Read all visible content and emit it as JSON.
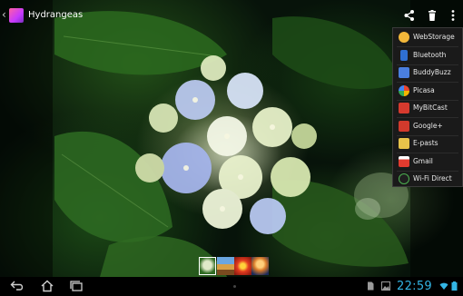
{
  "app": {
    "album_title": "Hydrangeas"
  },
  "action_bar": {
    "icons": [
      "back-caret-icon",
      "album-thumbnail-icon",
      "share-icon",
      "trash-icon",
      "overflow-menu-icon"
    ]
  },
  "share_menu": {
    "items": [
      {
        "label": "WebStorage",
        "icon": "webstorage-icon",
        "color": "#f2b73a"
      },
      {
        "label": "Bluetooth",
        "icon": "bluetooth-icon",
        "color": "#2f6fd1"
      },
      {
        "label": "BuddyBuzz",
        "icon": "buddybuzz-icon",
        "color": "#4a7fe0"
      },
      {
        "label": "Picasa",
        "icon": "picasa-icon",
        "color": "#e86a2f"
      },
      {
        "label": "MyBitCast",
        "icon": "mybitcast-icon",
        "color": "#d63a2e"
      },
      {
        "label": "Google+",
        "icon": "google-plus-icon",
        "color": "#d23a2c"
      },
      {
        "label": "E-pasts",
        "icon": "email-icon",
        "color": "#e8c34a"
      },
      {
        "label": "Gmail",
        "icon": "gmail-icon",
        "color": "#e33b2f"
      },
      {
        "label": "Wi-Fi Direct",
        "icon": "wifi-direct-icon",
        "color": "#4caf50"
      }
    ]
  },
  "filmstrip": {
    "thumbnails": [
      "hydrangea-thumb",
      "landscape-thumb",
      "flower-red-thumb",
      "jellyfish-thumb"
    ],
    "selected_index": 0
  },
  "navbar": {
    "clock": "22:59",
    "icons": [
      "back-icon",
      "home-icon",
      "recent-apps-icon",
      "document-icon",
      "gallery-icon",
      "wifi-icon",
      "battery-icon"
    ]
  },
  "colors": {
    "clock": "#33b5e5",
    "menu_background": "#1a1a1a"
  }
}
